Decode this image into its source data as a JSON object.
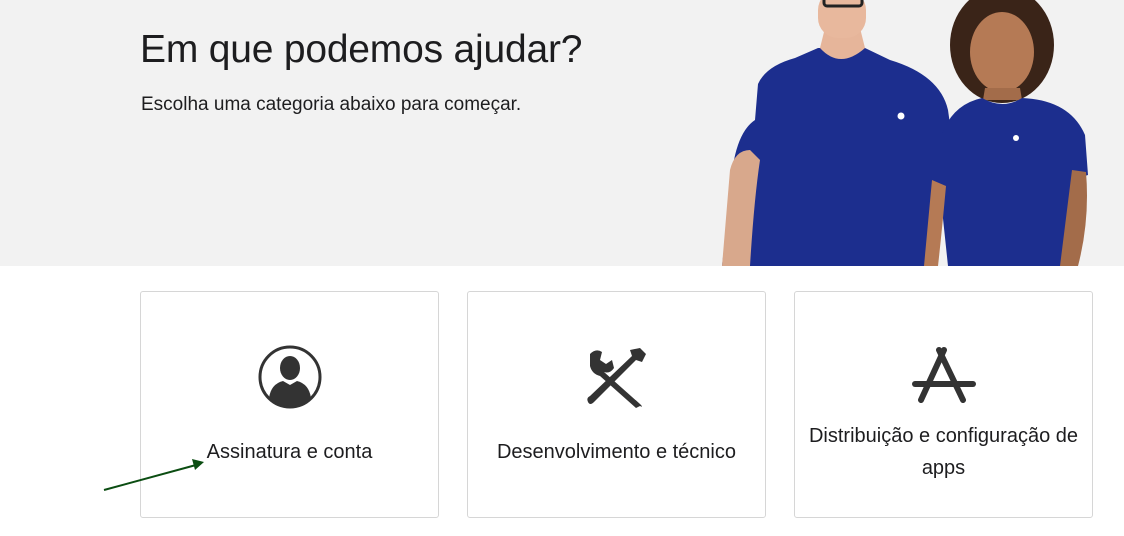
{
  "hero": {
    "title": "Em que podemos ajudar?",
    "subtitle": "Escolha uma categoria abaixo para começar."
  },
  "categories": [
    {
      "label": "Assinatura e conta",
      "icon": "person-icon"
    },
    {
      "label": "Desenvolvimento e técnico",
      "icon": "tools-icon"
    },
    {
      "label": "Distribuição e configuração de apps",
      "icon": "app-store-icon"
    }
  ],
  "colors": {
    "hero_bg": "#f2f2f2",
    "shirt": "#1c2e8e",
    "icon": "#333333",
    "annotation_arrow": "#0b4d12"
  }
}
